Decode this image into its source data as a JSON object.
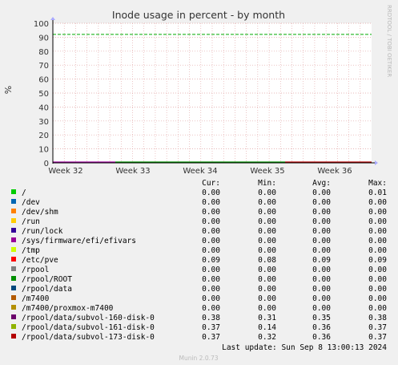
{
  "chart_data": {
    "type": "line",
    "title": "Inode usage in percent - by month",
    "ylabel": "%",
    "xlabel": "",
    "ylim": [
      0,
      100
    ],
    "yticks": [
      "0",
      "10",
      "20",
      "30",
      "40",
      "50",
      "60",
      "70",
      "80",
      "90",
      "100"
    ],
    "xticks": [
      "Week 32",
      "Week 33",
      "Week 34",
      "Week 35",
      "Week 36"
    ],
    "grid": true,
    "warning_level": 92,
    "colors": {
      "background": "#f0f0f0",
      "plot_bg": "#ffffff",
      "grid": "#e0a0a0",
      "warning_line": "#00aa00",
      "axis": "#000000"
    },
    "columns": [
      "Cur:",
      "Min:",
      "Avg:",
      "Max:"
    ],
    "series": [
      {
        "name": "/",
        "color": "#00cc00",
        "cur": "0.00",
        "min": "0.00",
        "avg": "0.00",
        "max": "0.01"
      },
      {
        "name": "/dev",
        "color": "#0066b3",
        "cur": "0.00",
        "min": "0.00",
        "avg": "0.00",
        "max": "0.00"
      },
      {
        "name": "/dev/shm",
        "color": "#ff8000",
        "cur": "0.00",
        "min": "0.00",
        "avg": "0.00",
        "max": "0.00"
      },
      {
        "name": "/run",
        "color": "#ffcc00",
        "cur": "0.00",
        "min": "0.00",
        "avg": "0.00",
        "max": "0.00"
      },
      {
        "name": "/run/lock",
        "color": "#330099",
        "cur": "0.00",
        "min": "0.00",
        "avg": "0.00",
        "max": "0.00"
      },
      {
        "name": "/sys/firmware/efi/efivars",
        "color": "#990099",
        "cur": "0.00",
        "min": "0.00",
        "avg": "0.00",
        "max": "0.00"
      },
      {
        "name": "/tmp",
        "color": "#ccff00",
        "cur": "0.00",
        "min": "0.00",
        "avg": "0.00",
        "max": "0.00"
      },
      {
        "name": "/etc/pve",
        "color": "#ff0000",
        "cur": "0.09",
        "min": "0.08",
        "avg": "0.09",
        "max": "0.09"
      },
      {
        "name": "/rpool",
        "color": "#808080",
        "cur": "0.00",
        "min": "0.00",
        "avg": "0.00",
        "max": "0.00"
      },
      {
        "name": "/rpool/ROOT",
        "color": "#008f00",
        "cur": "0.00",
        "min": "0.00",
        "avg": "0.00",
        "max": "0.00"
      },
      {
        "name": "/rpool/data",
        "color": "#00487d",
        "cur": "0.00",
        "min": "0.00",
        "avg": "0.00",
        "max": "0.00"
      },
      {
        "name": "/m7400",
        "color": "#b35a00",
        "cur": "0.00",
        "min": "0.00",
        "avg": "0.00",
        "max": "0.00"
      },
      {
        "name": "/m7400/proxmox-m7400",
        "color": "#b38f00",
        "cur": "0.00",
        "min": "0.00",
        "avg": "0.00",
        "max": "0.00"
      },
      {
        "name": "/rpool/data/subvol-160-disk-0",
        "color": "#6b006b",
        "cur": "0.38",
        "min": "0.31",
        "avg": "0.35",
        "max": "0.38"
      },
      {
        "name": "/rpool/data/subvol-161-disk-0",
        "color": "#8fb300",
        "cur": "0.37",
        "min": "0.14",
        "avg": "0.36",
        "max": "0.37"
      },
      {
        "name": "/rpool/data/subvol-173-disk-0",
        "color": "#b30000",
        "cur": "0.37",
        "min": "0.32",
        "avg": "0.36",
        "max": "0.37"
      }
    ]
  },
  "last_update": "Last update: Sun Sep  8 13:00:13 2024",
  "side_label": "RRDTOOL / TOBI OETIKER",
  "footer": "Munin 2.0.73"
}
